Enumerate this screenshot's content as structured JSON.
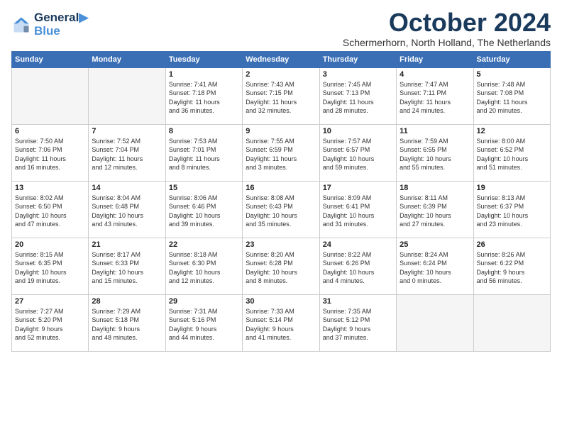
{
  "logo": {
    "line1": "General",
    "line2": "Blue"
  },
  "title": "October 2024",
  "location": "Schermerhorn, North Holland, The Netherlands",
  "days_header": [
    "Sunday",
    "Monday",
    "Tuesday",
    "Wednesday",
    "Thursday",
    "Friday",
    "Saturday"
  ],
  "weeks": [
    [
      {
        "num": "",
        "info": ""
      },
      {
        "num": "",
        "info": ""
      },
      {
        "num": "1",
        "info": "Sunrise: 7:41 AM\nSunset: 7:18 PM\nDaylight: 11 hours\nand 36 minutes."
      },
      {
        "num": "2",
        "info": "Sunrise: 7:43 AM\nSunset: 7:15 PM\nDaylight: 11 hours\nand 32 minutes."
      },
      {
        "num": "3",
        "info": "Sunrise: 7:45 AM\nSunset: 7:13 PM\nDaylight: 11 hours\nand 28 minutes."
      },
      {
        "num": "4",
        "info": "Sunrise: 7:47 AM\nSunset: 7:11 PM\nDaylight: 11 hours\nand 24 minutes."
      },
      {
        "num": "5",
        "info": "Sunrise: 7:48 AM\nSunset: 7:08 PM\nDaylight: 11 hours\nand 20 minutes."
      }
    ],
    [
      {
        "num": "6",
        "info": "Sunrise: 7:50 AM\nSunset: 7:06 PM\nDaylight: 11 hours\nand 16 minutes."
      },
      {
        "num": "7",
        "info": "Sunrise: 7:52 AM\nSunset: 7:04 PM\nDaylight: 11 hours\nand 12 minutes."
      },
      {
        "num": "8",
        "info": "Sunrise: 7:53 AM\nSunset: 7:01 PM\nDaylight: 11 hours\nand 8 minutes."
      },
      {
        "num": "9",
        "info": "Sunrise: 7:55 AM\nSunset: 6:59 PM\nDaylight: 11 hours\nand 3 minutes."
      },
      {
        "num": "10",
        "info": "Sunrise: 7:57 AM\nSunset: 6:57 PM\nDaylight: 10 hours\nand 59 minutes."
      },
      {
        "num": "11",
        "info": "Sunrise: 7:59 AM\nSunset: 6:55 PM\nDaylight: 10 hours\nand 55 minutes."
      },
      {
        "num": "12",
        "info": "Sunrise: 8:00 AM\nSunset: 6:52 PM\nDaylight: 10 hours\nand 51 minutes."
      }
    ],
    [
      {
        "num": "13",
        "info": "Sunrise: 8:02 AM\nSunset: 6:50 PM\nDaylight: 10 hours\nand 47 minutes."
      },
      {
        "num": "14",
        "info": "Sunrise: 8:04 AM\nSunset: 6:48 PM\nDaylight: 10 hours\nand 43 minutes."
      },
      {
        "num": "15",
        "info": "Sunrise: 8:06 AM\nSunset: 6:46 PM\nDaylight: 10 hours\nand 39 minutes."
      },
      {
        "num": "16",
        "info": "Sunrise: 8:08 AM\nSunset: 6:43 PM\nDaylight: 10 hours\nand 35 minutes."
      },
      {
        "num": "17",
        "info": "Sunrise: 8:09 AM\nSunset: 6:41 PM\nDaylight: 10 hours\nand 31 minutes."
      },
      {
        "num": "18",
        "info": "Sunrise: 8:11 AM\nSunset: 6:39 PM\nDaylight: 10 hours\nand 27 minutes."
      },
      {
        "num": "19",
        "info": "Sunrise: 8:13 AM\nSunset: 6:37 PM\nDaylight: 10 hours\nand 23 minutes."
      }
    ],
    [
      {
        "num": "20",
        "info": "Sunrise: 8:15 AM\nSunset: 6:35 PM\nDaylight: 10 hours\nand 19 minutes."
      },
      {
        "num": "21",
        "info": "Sunrise: 8:17 AM\nSunset: 6:33 PM\nDaylight: 10 hours\nand 15 minutes."
      },
      {
        "num": "22",
        "info": "Sunrise: 8:18 AM\nSunset: 6:30 PM\nDaylight: 10 hours\nand 12 minutes."
      },
      {
        "num": "23",
        "info": "Sunrise: 8:20 AM\nSunset: 6:28 PM\nDaylight: 10 hours\nand 8 minutes."
      },
      {
        "num": "24",
        "info": "Sunrise: 8:22 AM\nSunset: 6:26 PM\nDaylight: 10 hours\nand 4 minutes."
      },
      {
        "num": "25",
        "info": "Sunrise: 8:24 AM\nSunset: 6:24 PM\nDaylight: 10 hours\nand 0 minutes."
      },
      {
        "num": "26",
        "info": "Sunrise: 8:26 AM\nSunset: 6:22 PM\nDaylight: 9 hours\nand 56 minutes."
      }
    ],
    [
      {
        "num": "27",
        "info": "Sunrise: 7:27 AM\nSunset: 5:20 PM\nDaylight: 9 hours\nand 52 minutes."
      },
      {
        "num": "28",
        "info": "Sunrise: 7:29 AM\nSunset: 5:18 PM\nDaylight: 9 hours\nand 48 minutes."
      },
      {
        "num": "29",
        "info": "Sunrise: 7:31 AM\nSunset: 5:16 PM\nDaylight: 9 hours\nand 44 minutes."
      },
      {
        "num": "30",
        "info": "Sunrise: 7:33 AM\nSunset: 5:14 PM\nDaylight: 9 hours\nand 41 minutes."
      },
      {
        "num": "31",
        "info": "Sunrise: 7:35 AM\nSunset: 5:12 PM\nDaylight: 9 hours\nand 37 minutes."
      },
      {
        "num": "",
        "info": ""
      },
      {
        "num": "",
        "info": ""
      }
    ]
  ]
}
